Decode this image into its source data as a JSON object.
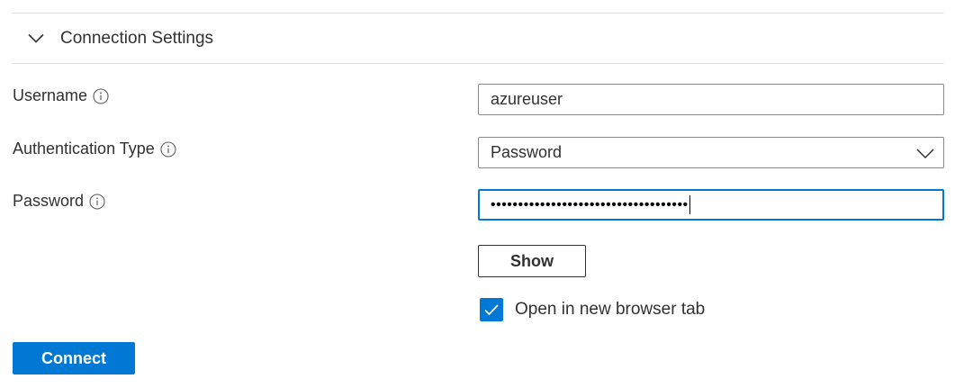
{
  "section": {
    "title": "Connection Settings",
    "expanded": true,
    "chevron_icon": "chevron-down-icon"
  },
  "fields": {
    "username": {
      "label": "Username",
      "value": "azureuser",
      "info_icon": "info-icon"
    },
    "auth_type": {
      "label": "Authentication Type",
      "selected": "Password",
      "info_icon": "info-icon"
    },
    "password": {
      "label": "Password",
      "masked_value": "••••••••••••••••••••••••••••••••••••",
      "info_icon": "info-icon"
    }
  },
  "show_button": {
    "label": "Show"
  },
  "open_new_tab": {
    "label": "Open in new browser tab",
    "checked": true
  },
  "connect_button": {
    "label": "Connect"
  },
  "colors": {
    "accent": "#0078d4",
    "divider": "#e1dfdd",
    "text": "#323130",
    "border": "#8a8886"
  }
}
